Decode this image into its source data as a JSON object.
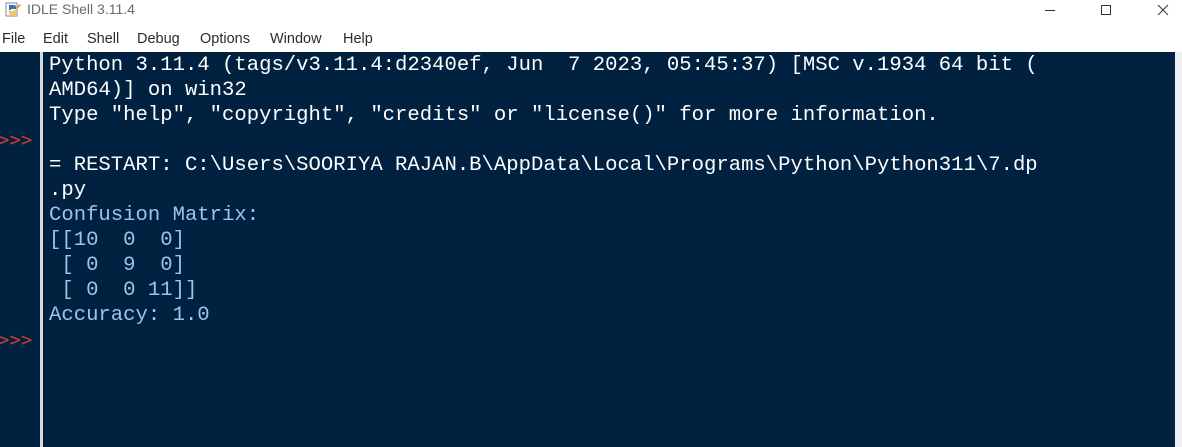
{
  "window": {
    "title": "IDLE Shell 3.11.4",
    "controls": {
      "minimize": "—",
      "maximize": "☐",
      "close": "✕"
    }
  },
  "menubar": {
    "items": [
      "File",
      "Edit",
      "Shell",
      "Debug",
      "Options",
      "Window",
      "Help"
    ]
  },
  "gutter": {
    "prompts": [
      ">>>",
      ">>>"
    ]
  },
  "shell": {
    "lines": [
      "Python 3.11.4 (tags/v3.11.4:d2340ef, Jun  7 2023, 05:45:37) [MSC v.1934 64 bit (",
      "AMD64)] on win32",
      "Type \"help\", \"copyright\", \"credits\" or \"license()\" for more information.",
      "",
      "= RESTART: C:\\Users\\SOORIYA RAJAN.B\\AppData\\Local\\Programs\\Python\\Python311\\7.dp",
      ".py",
      "Confusion Matrix:",
      "[[10  0  0]",
      " [ 0  9  0]",
      " [ 0  0 11]]",
      "Accuracy: 1.0"
    ]
  },
  "colors": {
    "shell_background": "#002240",
    "stdout_text": "#9fc2e6",
    "shell_text": "#ffffff",
    "prompt": "#cf3a3a"
  },
  "icons": {
    "app": "python-idle-icon"
  }
}
